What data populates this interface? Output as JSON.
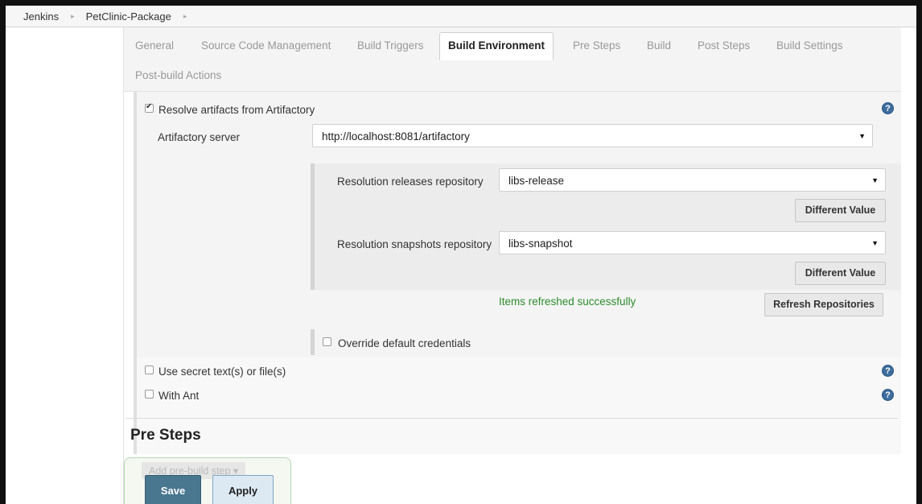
{
  "breadcrumb": {
    "items": [
      "Jenkins",
      "PetClinic-Package"
    ],
    "separator": "▸"
  },
  "tabs": [
    {
      "label": "General"
    },
    {
      "label": "Source Code Management"
    },
    {
      "label": "Build Triggers"
    },
    {
      "label": "Build Environment",
      "active": true
    },
    {
      "label": "Pre Steps"
    },
    {
      "label": "Build"
    },
    {
      "label": "Post Steps"
    },
    {
      "label": "Build Settings"
    },
    {
      "label": "Post-build Actions"
    }
  ],
  "resolve": {
    "label": "Resolve artifacts from Artifactory",
    "checked": true,
    "server_label": "Artifactory server",
    "server_value": "http://localhost:8081/artifactory",
    "releases_label": "Resolution releases repository",
    "releases_value": "libs-release",
    "snapshots_label": "Resolution snapshots repository",
    "snapshots_value": "libs-snapshot",
    "different_value_label": "Different Value",
    "status_text": "Items refreshed successfully",
    "refresh_label": "Refresh Repositories",
    "override_label": "Override default credentials",
    "override_checked": false
  },
  "options": {
    "secret_label": "Use secret text(s) or file(s)",
    "ant_label": "With Ant"
  },
  "pre_steps": {
    "heading": "Pre Steps",
    "add_label": "Add pre-build step ▾"
  },
  "footer": {
    "save_label": "Save",
    "apply_label": "Apply"
  },
  "icons": {
    "help": "help-icon",
    "caret": "chevron-down-icon",
    "checkmark": "check-icon"
  },
  "colors": {
    "success": "#2d8c2d",
    "save_button": "#4a7790",
    "apply_button": "#dce9f3",
    "help_icon": "#3d6d9c"
  }
}
